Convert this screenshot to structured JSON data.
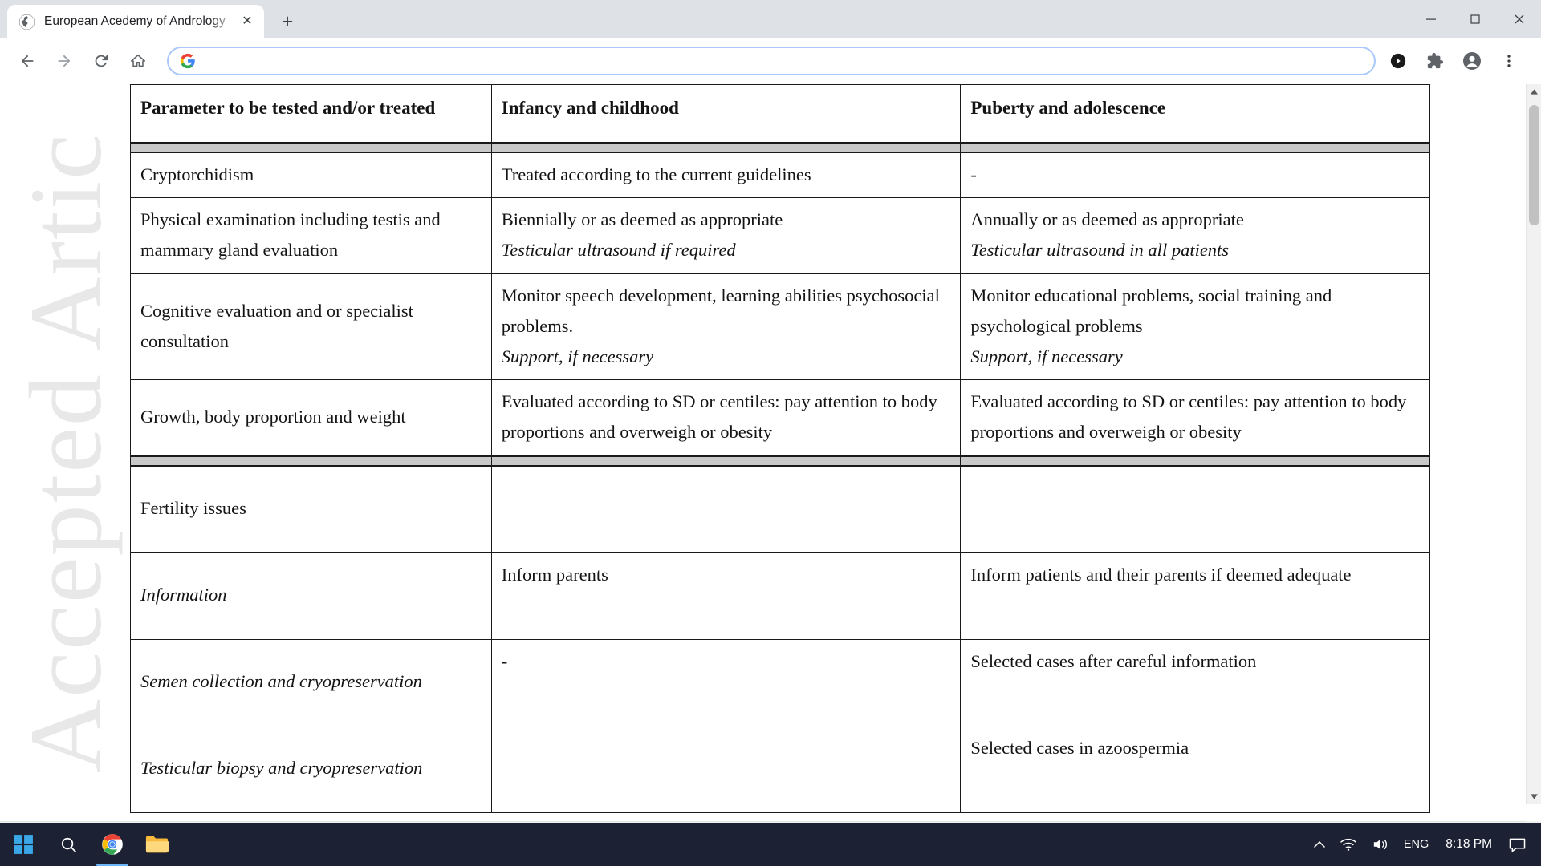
{
  "browser": {
    "tab": {
      "title": "European Acedemy of Andrology",
      "favicon": "globe-icon",
      "close": "✕"
    },
    "new_tab_label": "+",
    "window_controls": {
      "minimize": "–",
      "maximize": "❐",
      "close": "✕"
    },
    "toolbar": {
      "back": "←",
      "forward": "→",
      "reload": "↻",
      "home": "⌂",
      "address_value": "",
      "address_placeholder": "",
      "share_icon": "share-icon",
      "extensions_icon": "puzzle-icon",
      "profile_icon": "account-icon",
      "menu_icon": "three-dot-menu-icon"
    }
  },
  "document": {
    "watermark": "Accepted Artic",
    "table": {
      "headers": [
        "Parameter to be tested and/or treated",
        "Infancy and childhood",
        "Puberty and adolescence"
      ],
      "rows": [
        {
          "parameter": [
            {
              "text": "Cryptorchidism",
              "style": "plain"
            }
          ],
          "infancy": [
            {
              "text": "Treated according to the current guidelines",
              "style": "plain"
            }
          ],
          "puberty": [
            {
              "text": "-",
              "style": "plain"
            }
          ]
        },
        {
          "parameter": [
            {
              "text": "Physical examination including testis and mammary gland evaluation",
              "style": "plain"
            }
          ],
          "infancy": [
            {
              "text": "Biennially or as deemed as appropriate",
              "style": "plain"
            },
            {
              "text": "Testicular ultrasound if required",
              "style": "ital"
            }
          ],
          "puberty": [
            {
              "text": "Annually or as deemed as appropriate",
              "style": "plain"
            },
            {
              "text": "Testicular ultrasound in all patients",
              "style": "ital"
            }
          ]
        },
        {
          "parameter": [
            {
              "text": "Cognitive evaluation and or specialist consultation",
              "style": "plain"
            }
          ],
          "infancy": [
            {
              "text": "Monitor speech development, learning abilities psychosocial problems.",
              "style": "plain"
            },
            {
              "text": "Support, if necessary",
              "style": "ital"
            }
          ],
          "puberty": [
            {
              "text": "Monitor educational problems, social training and psychological problems",
              "style": "plain"
            },
            {
              "text": "Support, if necessary",
              "style": "ital"
            }
          ]
        },
        {
          "parameter": [
            {
              "text": "Growth, body proportion and weight",
              "style": "plain"
            }
          ],
          "infancy": [
            {
              "text": "Evaluated according to SD or centiles: pay attention to body proportions and overweigh or obesity",
              "style": "plain"
            }
          ],
          "puberty": [
            {
              "text": "Evaluated according to SD or centiles: pay attention to body proportions and overweigh or obesity",
              "style": "plain"
            }
          ]
        }
      ],
      "section2_rows": [
        {
          "parameter": [
            {
              "text": "Fertility issues",
              "style": "plain"
            }
          ],
          "infancy": [
            {
              "text": "",
              "style": "plain"
            }
          ],
          "puberty": [
            {
              "text": "",
              "style": "plain"
            }
          ]
        },
        {
          "parameter": [
            {
              "text": "Information",
              "style": "ital"
            }
          ],
          "infancy": [
            {
              "text": "Inform parents",
              "style": "plain"
            }
          ],
          "puberty": [
            {
              "text": "Inform patients and their parents if  deemed adequate",
              "style": "plain"
            }
          ]
        },
        {
          "parameter": [
            {
              "text": "Semen collection and cryopreservation",
              "style": "ital"
            }
          ],
          "infancy": [
            {
              "text": "-",
              "style": "plain"
            }
          ],
          "puberty": [
            {
              "text": "Selected cases after careful information",
              "style": "plain"
            }
          ]
        },
        {
          "parameter": [
            {
              "text": "Testicular biopsy and cryopreservation",
              "style": "ital"
            }
          ],
          "infancy": [
            {
              "text": "",
              "style": "plain"
            }
          ],
          "puberty": [
            {
              "text": "Selected cases in azoospermia",
              "style": "plain"
            }
          ]
        }
      ]
    }
  },
  "taskbar": {
    "start_icon": "windows-start-icon",
    "search_icon": "search-icon",
    "chrome_icon": "chrome-icon",
    "explorer_icon": "file-explorer-icon",
    "tray": {
      "chevron": "∧",
      "network_icon": "wifi-icon",
      "volume_icon": "speaker-icon",
      "language": "ENG",
      "time": "8:18 PM",
      "notifications_icon": "notification-icon"
    }
  },
  "colors": {
    "tabstrip_bg": "#dee1e6",
    "omnibox_border": "#a8c7fa",
    "taskbar_bg": "#1c2233",
    "table_border": "#1a1a1a",
    "section_divider": "#c9c9c9",
    "watermark": "#e8e8e8"
  }
}
